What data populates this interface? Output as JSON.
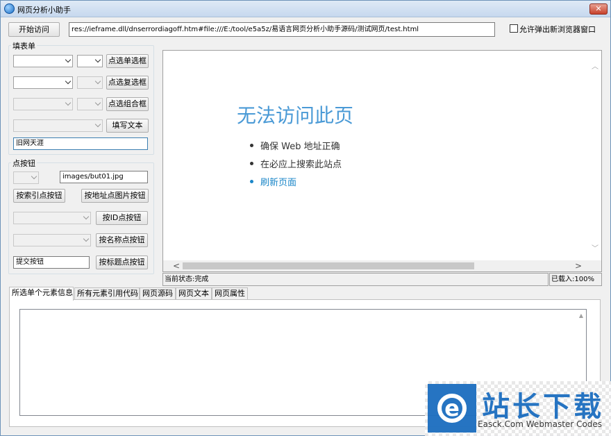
{
  "window": {
    "title": "网页分析小助手",
    "close_label": "✕"
  },
  "toolbar": {
    "visit_label": "开始访问",
    "url_value": "res://ieframe.dll/dnserrordiagoff.htm#file:///E:/tool/e5a5z/易语言网页分析小助手源码/测试网页/test.html",
    "allow_popup_label": "允许弹出新浏览器窗口"
  },
  "form_group": {
    "title": "填表单",
    "select_single_label": "点选单选框",
    "select_multi_label": "点选复选框",
    "select_combo_label": "点选组合框",
    "fill_text_label": "填写文本",
    "text_input_value": "旧网天涯"
  },
  "button_group": {
    "title": "点按钮",
    "image_path_value": "images/but01.jpg",
    "click_by_index_label": "按索引点按钮",
    "click_by_image_label": "按地址点图片按钮",
    "click_by_id_label": "按ID点按钮",
    "click_by_name_label": "按名称点按钮",
    "button_title_value": "提交按钮",
    "click_by_title_label": "按标题点按钮"
  },
  "browser": {
    "heading": "无法访问此页",
    "items": [
      {
        "text": "确保 Web 地址正确"
      },
      {
        "text": "在必应上搜索此站点"
      },
      {
        "text": "刷新页面"
      }
    ]
  },
  "status": {
    "state_text": "当前状态:完成",
    "loaded_text": "已载入:100%"
  },
  "tabs": [
    {
      "label": "所选单个元素信息"
    },
    {
      "label": "所有元素引用代码"
    },
    {
      "label": "网页源码"
    },
    {
      "label": "网页文本"
    },
    {
      "label": "网页属性"
    }
  ],
  "watermark": {
    "logo_letter": "e",
    "brand_cn": "站长下载",
    "brand_en": "Easck.Com Webmaster Codes"
  },
  "colors": {
    "accent": "#4a9ad6",
    "link": "#1a86c8",
    "brand": "#1e6fc0"
  }
}
